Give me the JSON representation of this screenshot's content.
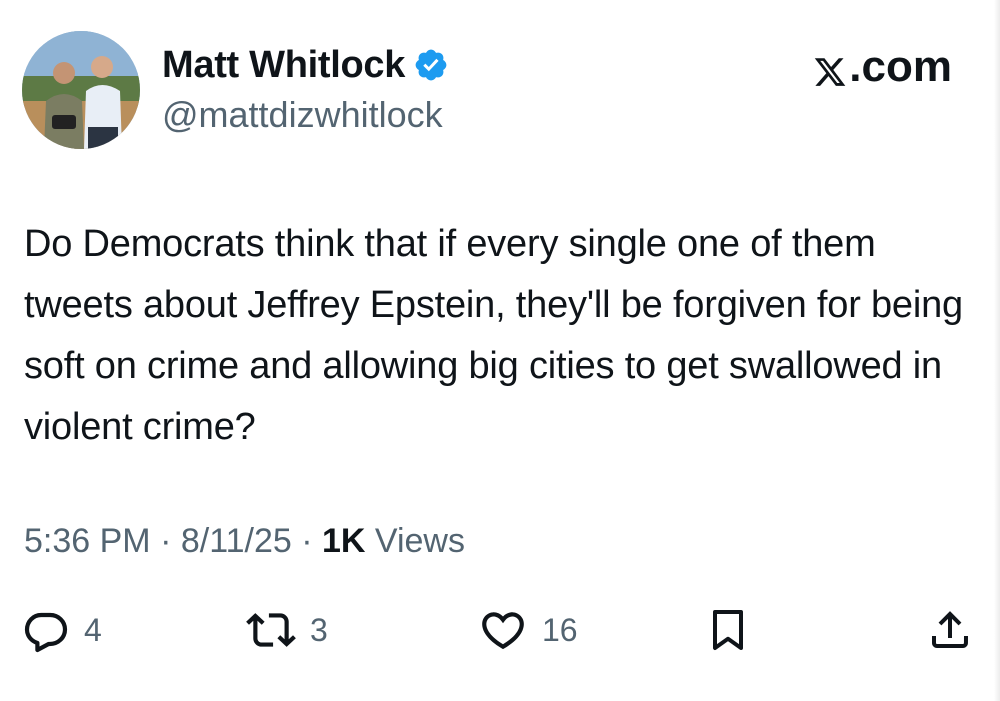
{
  "author": {
    "display_name": "Matt Whitlock",
    "handle": "@mattdizwhitlock",
    "verified": true
  },
  "brand": {
    "logo_icon": "x-logo-icon",
    "label": ".com"
  },
  "tweet": {
    "text": "Do Democrats think that if every single one of them tweets about Jeffrey Epstein, they'll be forgiven for being soft on crime and allowing big cities to get swallowed in violent crime?"
  },
  "meta": {
    "time": "5:36 PM",
    "separator1": " · ",
    "date": "8/11/25",
    "separator2": " · ",
    "views_count": "1K",
    "views_label": " Views"
  },
  "actions": {
    "reply": {
      "icon": "reply-icon",
      "count": "4"
    },
    "retweet": {
      "icon": "retweet-icon",
      "count": "3"
    },
    "like": {
      "icon": "heart-icon",
      "count": "16"
    },
    "bookmark": {
      "icon": "bookmark-icon"
    },
    "share": {
      "icon": "share-icon"
    }
  },
  "colors": {
    "text_primary": "#0f1419",
    "text_secondary": "#536471",
    "verified_blue": "#1d9bf0"
  }
}
